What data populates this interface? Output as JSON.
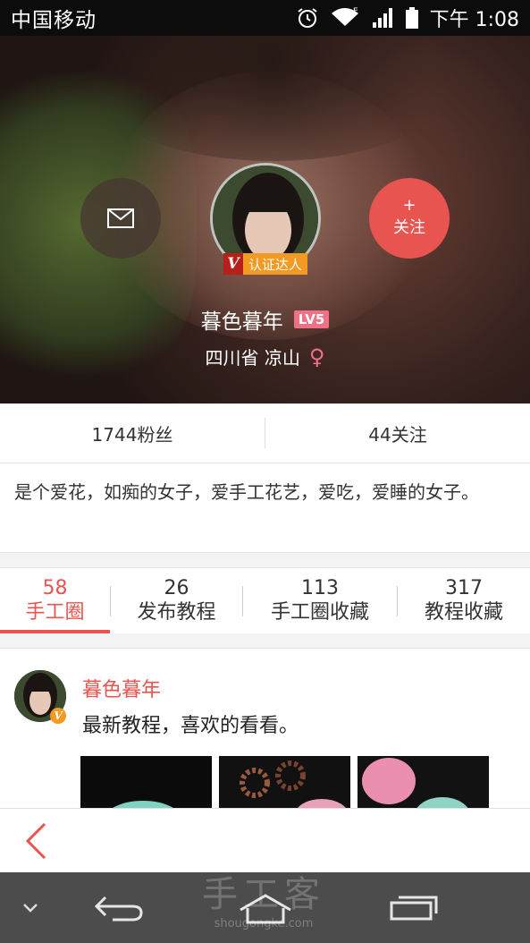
{
  "status_bar": {
    "carrier": "中国移动",
    "network": "E",
    "time": "下午 1:08",
    "icons": [
      "alarm-icon",
      "wifi-icon",
      "signal-icon",
      "battery-icon"
    ]
  },
  "profile": {
    "message_icon": "envelope-icon",
    "follow_plus": "+",
    "follow_label": "关注",
    "verify_v": "V",
    "verify_text": "认证达人",
    "username": "暮色暮年",
    "level": "LV5",
    "location": "四川省 凉山",
    "gender_symbol": "♀"
  },
  "stats": {
    "fans": "1744粉丝",
    "following": "44关注"
  },
  "bio": "是个爱花，如痴的女子，爱手工花艺，爱吃，爱睡的女子。",
  "tabs": [
    {
      "count": "58",
      "label": "手工圈"
    },
    {
      "count": "26",
      "label": "发布教程"
    },
    {
      "count": "113",
      "label": "手工圈收藏"
    },
    {
      "count": "317",
      "label": "教程收藏"
    }
  ],
  "post": {
    "author": "暮色暮年",
    "badge": "V",
    "text": "最新教程，喜欢的看看。"
  },
  "watermark": {
    "title": "手工客",
    "url": "shougongke.com"
  },
  "colors": {
    "accent": "#e8544f",
    "badge_orange": "#f29a22",
    "level_pink": "#f07088"
  }
}
